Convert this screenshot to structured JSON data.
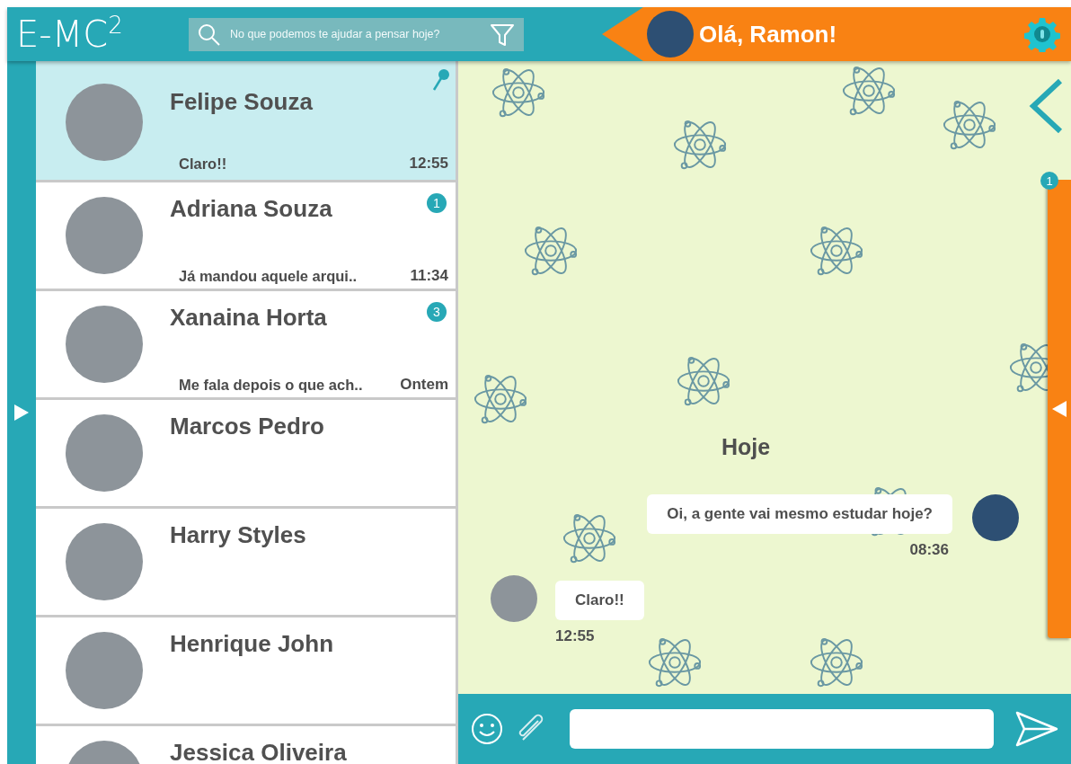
{
  "header": {
    "logo": "E-MC$^{2}$",
    "search": {
      "placeholder": "No que podemos te ajudar a pensar hoje?"
    },
    "greeting": "Olá, Ramon!"
  },
  "chats": [
    {
      "name": "Felipe Souza",
      "preview": "Claro!!",
      "time": "12:55",
      "selected": true,
      "pinned": true
    },
    {
      "name": "Adriana Souza",
      "preview": "Já mandou aquele arqui..",
      "time": "11:34",
      "badge": "1",
      "selected": false,
      "pinned": false
    },
    {
      "name": "Xanaina Horta",
      "preview": "Me fala depois o que ach..",
      "time": "Ontem",
      "badge": "3",
      "selected": false,
      "pinned": false
    },
    {
      "name": "Marcos Pedro",
      "selected": false,
      "pinned": false
    },
    {
      "name": "Harry Styles",
      "selected": false,
      "pinned": false
    },
    {
      "name": "Henrique John",
      "selected": false,
      "pinned": false
    },
    {
      "name": "Jessica Oliveira",
      "selected": false,
      "pinned": false
    }
  ],
  "conversation": {
    "day": "Hoje",
    "messages": [
      {
        "kind": "sent",
        "text": "Oi, a gente vai mesmo estudar hoje?",
        "time": "08:36"
      },
      {
        "kind": "received",
        "text": "Claro!!",
        "time": "12:55"
      }
    ]
  },
  "side_panel": {
    "badge": "1"
  }
}
